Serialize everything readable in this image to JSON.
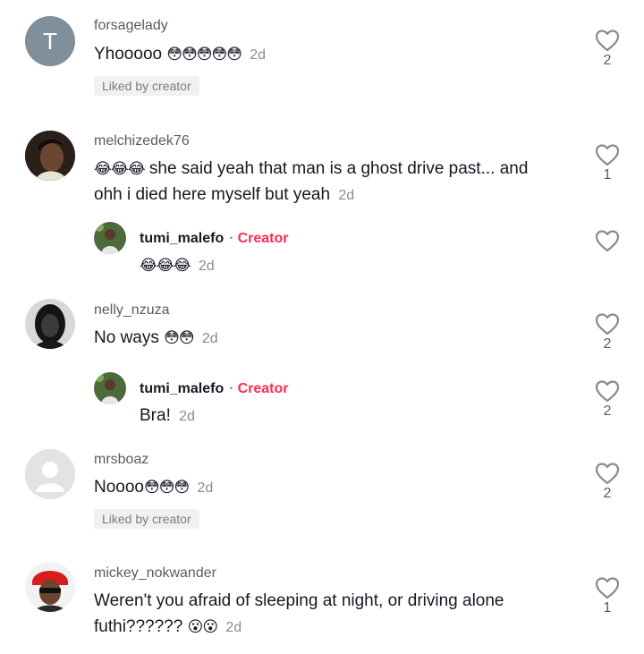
{
  "comments": [
    {
      "username": "forsagelady",
      "avatar_letter": "T",
      "avatar_color": "#7f8f9c",
      "text": "Yhooooo",
      "emojis": "😳😳😳😳😳",
      "age": "2d",
      "liked_by_creator": "Liked by creator",
      "like_count": "2"
    },
    {
      "username": "melchizedek76",
      "text_pre_emojis": "😂😂😂",
      "text": " she said yeah that man is a ghost drive past... and ohh i died here myself but yeah",
      "age": "2d",
      "like_count": "1"
    },
    {
      "reply": true,
      "username": "tumi_malefo",
      "separator": "·",
      "creator_label": "Creator",
      "emojis": "😂😂😂",
      "age": "2d",
      "like_count": ""
    },
    {
      "username": "nelly_nzuza",
      "text": "No ways",
      "emojis": "😳😳",
      "age": "2d",
      "like_count": "2"
    },
    {
      "reply": true,
      "username": "tumi_malefo",
      "separator": "·",
      "creator_label": "Creator",
      "text": "Bra!",
      "age": "2d",
      "like_count": "2"
    },
    {
      "username": "mrsboaz",
      "text": "Noooo",
      "emojis": "😳😳😳",
      "age": "2d",
      "liked_by_creator": "Liked by creator",
      "like_count": "2"
    },
    {
      "username": "mickey_nokwander",
      "text": "Weren't you afraid of sleeping at night, or driving alone futhi??????",
      "emojis": "😮😮",
      "age": "2d",
      "like_count": "1"
    }
  ],
  "icons": {
    "like": "heart-outline-icon"
  },
  "colors": {
    "creator": "#fe2c55",
    "muted": "#8a8b91"
  }
}
